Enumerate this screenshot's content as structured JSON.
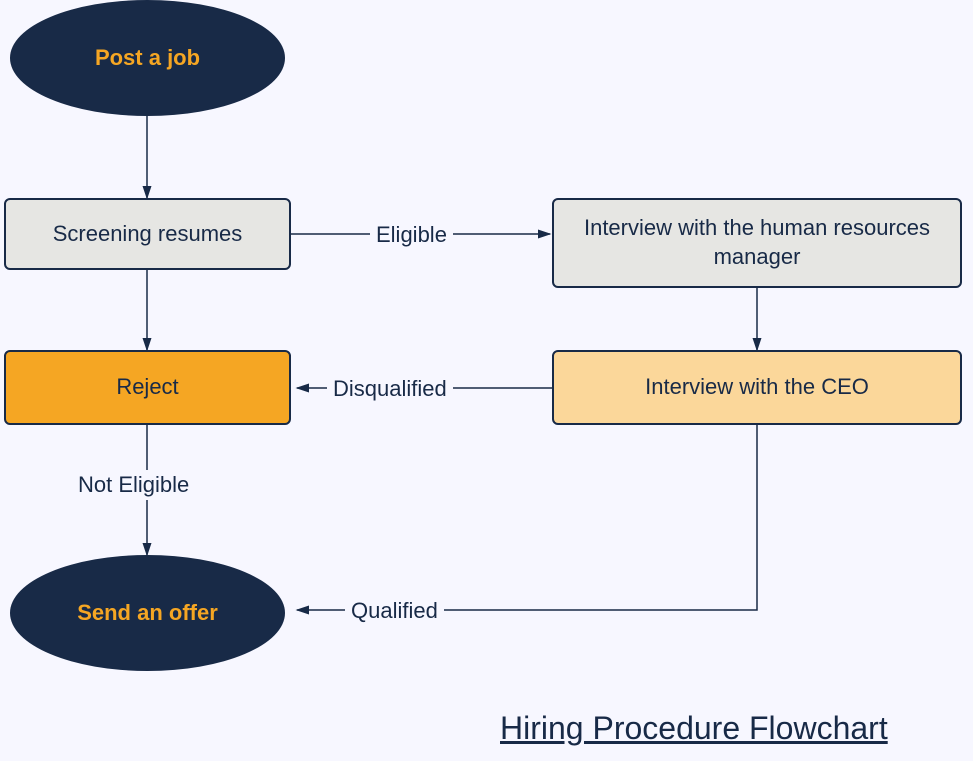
{
  "title": "Hiring Procedure Flowchart",
  "nodes": {
    "post_job": "Post a job",
    "screening": "Screening resumes",
    "interview_hr": "Interview with the human resources manager",
    "reject": "Reject",
    "interview_ceo": "Interview with the CEO",
    "send_offer": "Send an offer"
  },
  "edges": {
    "eligible": "Eligible",
    "disqualified": "Disqualified",
    "not_eligible": "Not Eligible",
    "qualified": "Qualified"
  }
}
